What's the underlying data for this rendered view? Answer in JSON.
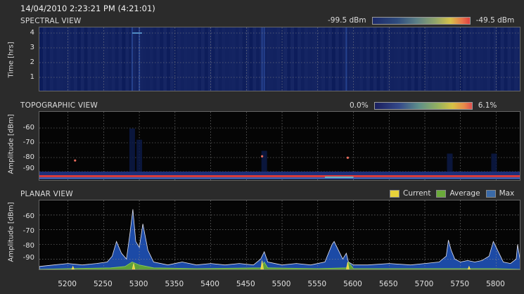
{
  "timestamp": "14/04/2010 2:23:21 PM (4:21:01)",
  "colors": {
    "background": "#2b2b2b",
    "spectral_bg": "#0f1e5a",
    "topo_bg": "#050505",
    "planar_bg": "#050505",
    "current": "#e8d23a",
    "average": "#6aaa3a",
    "max": "#1f4fa8",
    "grid": "#7a7a7a"
  },
  "spectral": {
    "title": "SPECTRAL VIEW",
    "ylabel": "Time [hrs]",
    "yticks": [
      "4",
      "3",
      "2",
      "1"
    ],
    "scale_min": "-99.5 dBm",
    "scale_max": "-49.5 dBm"
  },
  "topographic": {
    "title": "TOPOGRAPHIC VIEW",
    "ylabel": "Amplitude [dBm]",
    "yticks": [
      "-60",
      "-70",
      "-80",
      "-90"
    ],
    "scale_min": "0.0%",
    "scale_max": "6.1%"
  },
  "planar": {
    "title": "PLANAR VIEW",
    "ylabel": "Amplitude [dBm]",
    "yticks": [
      "-60",
      "-70",
      "-80",
      "-90"
    ],
    "legend": {
      "current": "Current",
      "average": "Average",
      "max": "Max"
    }
  },
  "xticks": [
    "5200",
    "5250",
    "5300",
    "5350",
    "5400",
    "5450",
    "5500",
    "5550",
    "5600",
    "5650",
    "5700",
    "5750",
    "5800"
  ],
  "chart_data": {
    "type": "area",
    "xlim": [
      5160,
      5835
    ],
    "ylim": [
      -98,
      -50
    ],
    "series": [
      {
        "name": "Max",
        "x": [
          5160,
          5180,
          5200,
          5220,
          5240,
          5255,
          5262,
          5268,
          5275,
          5282,
          5287,
          5291,
          5295,
          5300,
          5305,
          5312,
          5320,
          5340,
          5360,
          5380,
          5400,
          5420,
          5440,
          5460,
          5470,
          5475,
          5480,
          5500,
          5520,
          5540,
          5560,
          5570,
          5573,
          5578,
          5585,
          5590,
          5593,
          5600,
          5620,
          5650,
          5680,
          5700,
          5720,
          5730,
          5733,
          5737,
          5742,
          5750,
          5760,
          5770,
          5780,
          5790,
          5796,
          5800,
          5810,
          5820,
          5828,
          5830,
          5835
        ],
        "values": [
          -95,
          -94,
          -93,
          -94,
          -93,
          -92,
          -88,
          -78,
          -86,
          -90,
          -72,
          -56,
          -78,
          -82,
          -66,
          -84,
          -92,
          -94,
          -92,
          -94,
          -93,
          -94,
          -93,
          -94,
          -90,
          -85,
          -92,
          -94,
          -93,
          -94,
          -92,
          -80,
          -78,
          -83,
          -90,
          -86,
          -92,
          -94,
          -94,
          -93,
          -94,
          -93,
          -92,
          -88,
          -77,
          -84,
          -90,
          -92,
          -91,
          -92,
          -91,
          -88,
          -78,
          -82,
          -92,
          -93,
          -90,
          -80,
          -95
        ]
      },
      {
        "name": "Average",
        "x": [
          5160,
          5200,
          5260,
          5280,
          5290,
          5300,
          5320,
          5380,
          5470,
          5475,
          5480,
          5550,
          5590,
          5593,
          5600,
          5700,
          5800,
          5835
        ],
        "values": [
          -97,
          -96.5,
          -96,
          -95,
          -92,
          -94,
          -96,
          -96.5,
          -96,
          -92,
          -96,
          -96.5,
          -96,
          -92,
          -96.5,
          -96.5,
          -96.5,
          -97
        ]
      },
      {
        "name": "Current",
        "x": [
          5160,
          5205,
          5207,
          5209,
          5290,
          5292,
          5294,
          5470,
          5472,
          5474,
          5590,
          5592,
          5594,
          5760,
          5762,
          5764,
          5835
        ],
        "values": [
          -97.5,
          -97.5,
          -95,
          -97.5,
          -97.5,
          -93,
          -97.5,
          -97.5,
          -91,
          -97.5,
          -97.5,
          -92,
          -97.5,
          -97.5,
          -95,
          -97.5,
          -97.5
        ]
      }
    ]
  }
}
